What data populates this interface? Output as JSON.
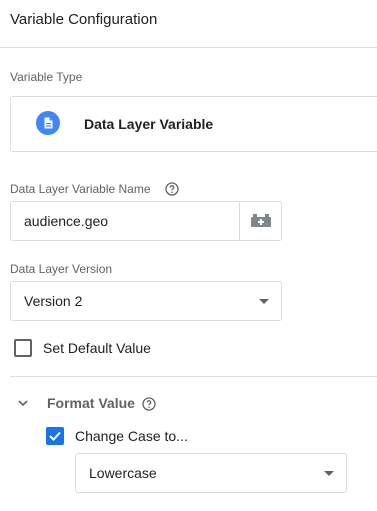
{
  "header": {
    "title": "Variable Configuration"
  },
  "variable_type": {
    "label": "Variable Type",
    "selected": "Data Layer Variable",
    "icon": "document-icon"
  },
  "dlv_name": {
    "label": "Data Layer Variable Name",
    "value": "audience.geo",
    "help_icon": "help-circle-icon",
    "picker_icon": "variable-picker-icon"
  },
  "dl_version": {
    "label": "Data Layer Version",
    "selected": "Version 2"
  },
  "default_value": {
    "label": "Set Default Value",
    "checked": false
  },
  "format_value": {
    "title": "Format Value",
    "expanded": true,
    "change_case": {
      "label": "Change Case to...",
      "checked": true,
      "selected": "Lowercase"
    }
  },
  "colors": {
    "accent": "#1a73e8",
    "icon_blue": "#4285f4",
    "border": "#dadce0",
    "text_secondary": "#5f6368"
  }
}
